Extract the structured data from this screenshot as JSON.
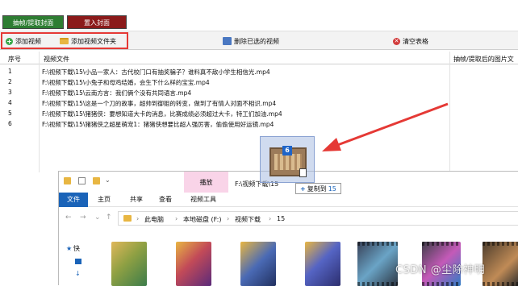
{
  "tabs": {
    "extract": "抽帧/提取封面",
    "import": "置入封面"
  },
  "toolbar": {
    "add_video": "添加视频",
    "add_video_folder": "添加视频文件夹",
    "delete_selected": "删除已选的视频",
    "clear_table": "清空表格"
  },
  "table": {
    "headers": {
      "index": "序号",
      "video_file": "视频文件",
      "output": "抽帧/提取后的图片文"
    },
    "rows": [
      {
        "index": "1",
        "file": "F:\\视频下载\\15\\小品一家人：古代校门口有抽奖骗子？谁料真不敌小学生相信光.mp4"
      },
      {
        "index": "2",
        "file": "F:\\视频下载\\15\\小兔子和母鸡结婚，会生下什么样的宝宝.mp4"
      },
      {
        "index": "3",
        "file": "F:\\视频下载\\15\\云南方言：我们俩个没有共同语言.mp4"
      },
      {
        "index": "4",
        "file": "F:\\视频下载\\15\\这是一个刀的故事，超帅到御姐的转变，做到了有情人对面不相识.mp4"
      },
      {
        "index": "5",
        "file": "F:\\视频下载\\15\\猪猪侠：要想知道大卡的消息，比赛成绩必须超过大卡，特工们加油.mp4"
      },
      {
        "index": "6",
        "file": "F:\\视频下载\\15\\猪猪侠之超星萌宠1：猪猪侠想要比超人强厉害，偷偷使用好运镜.mp4"
      }
    ]
  },
  "drag": {
    "count": "6"
  },
  "explorer": {
    "context_tab": "播放",
    "path_title": "F:\\视频下载\\15",
    "ribbon": {
      "file": "文件",
      "home": "主页",
      "share": "共享",
      "view": "查看",
      "video_tools": "视频工具"
    },
    "copy_tip": {
      "plus": "+",
      "action": "复制到",
      "target": "15"
    },
    "breadcrumb": [
      "此电脑",
      "本地磁盘 (F:)",
      "视频下载",
      "15"
    ],
    "nav_items": {
      "quick": "快"
    },
    "nav_glyphs": {
      "back": "←",
      "forward": "→",
      "up": "↑",
      "dropdown": "⌄",
      "separator": "›"
    }
  },
  "watermark": "CSDN @尘除神明",
  "colors": {
    "accent": "#1a63b8",
    "extract_tab": "#2e7d32",
    "import_tab": "#8b1a1a",
    "highlight": "#e53935",
    "arrow": "#e53935"
  }
}
